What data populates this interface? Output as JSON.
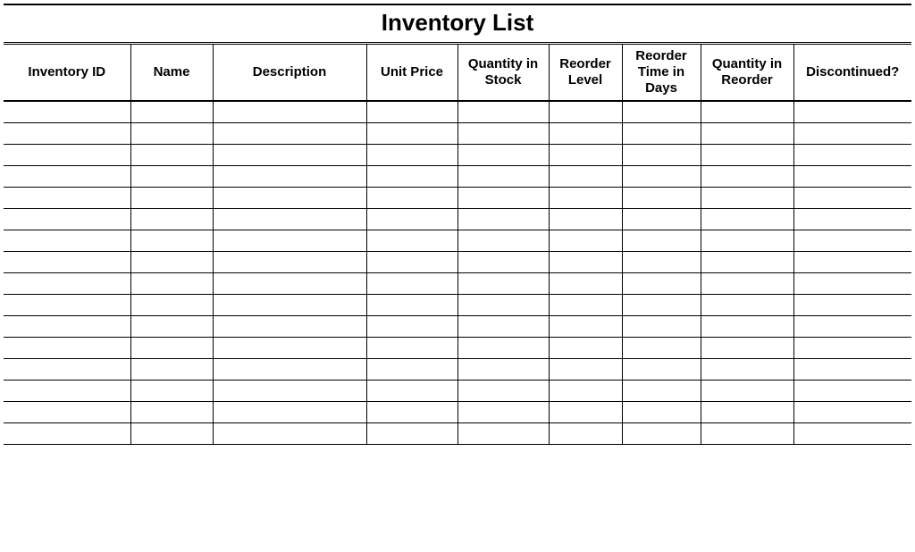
{
  "title": "Inventory List",
  "columns": [
    {
      "key": "inventory_id",
      "label": "Inventory ID"
    },
    {
      "key": "name",
      "label": "Name"
    },
    {
      "key": "description",
      "label": "Description"
    },
    {
      "key": "unit_price",
      "label": "Unit Price"
    },
    {
      "key": "qty_in_stock",
      "label": "Quantity in Stock"
    },
    {
      "key": "reorder_level",
      "label": "Reorder Level"
    },
    {
      "key": "reorder_time_days",
      "label": "Reorder Time in Days"
    },
    {
      "key": "qty_in_reorder",
      "label": "Quantity in Reorder"
    },
    {
      "key": "discontinued",
      "label": "Discontinued?"
    }
  ],
  "rows": [
    {
      "inventory_id": "",
      "name": "",
      "description": "",
      "unit_price": "",
      "qty_in_stock": "",
      "reorder_level": "",
      "reorder_time_days": "",
      "qty_in_reorder": "",
      "discontinued": ""
    },
    {
      "inventory_id": "",
      "name": "",
      "description": "",
      "unit_price": "",
      "qty_in_stock": "",
      "reorder_level": "",
      "reorder_time_days": "",
      "qty_in_reorder": "",
      "discontinued": ""
    },
    {
      "inventory_id": "",
      "name": "",
      "description": "",
      "unit_price": "",
      "qty_in_stock": "",
      "reorder_level": "",
      "reorder_time_days": "",
      "qty_in_reorder": "",
      "discontinued": ""
    },
    {
      "inventory_id": "",
      "name": "",
      "description": "",
      "unit_price": "",
      "qty_in_stock": "",
      "reorder_level": "",
      "reorder_time_days": "",
      "qty_in_reorder": "",
      "discontinued": ""
    },
    {
      "inventory_id": "",
      "name": "",
      "description": "",
      "unit_price": "",
      "qty_in_stock": "",
      "reorder_level": "",
      "reorder_time_days": "",
      "qty_in_reorder": "",
      "discontinued": ""
    },
    {
      "inventory_id": "",
      "name": "",
      "description": "",
      "unit_price": "",
      "qty_in_stock": "",
      "reorder_level": "",
      "reorder_time_days": "",
      "qty_in_reorder": "",
      "discontinued": ""
    },
    {
      "inventory_id": "",
      "name": "",
      "description": "",
      "unit_price": "",
      "qty_in_stock": "",
      "reorder_level": "",
      "reorder_time_days": "",
      "qty_in_reorder": "",
      "discontinued": ""
    },
    {
      "inventory_id": "",
      "name": "",
      "description": "",
      "unit_price": "",
      "qty_in_stock": "",
      "reorder_level": "",
      "reorder_time_days": "",
      "qty_in_reorder": "",
      "discontinued": ""
    },
    {
      "inventory_id": "",
      "name": "",
      "description": "",
      "unit_price": "",
      "qty_in_stock": "",
      "reorder_level": "",
      "reorder_time_days": "",
      "qty_in_reorder": "",
      "discontinued": ""
    },
    {
      "inventory_id": "",
      "name": "",
      "description": "",
      "unit_price": "",
      "qty_in_stock": "",
      "reorder_level": "",
      "reorder_time_days": "",
      "qty_in_reorder": "",
      "discontinued": ""
    },
    {
      "inventory_id": "",
      "name": "",
      "description": "",
      "unit_price": "",
      "qty_in_stock": "",
      "reorder_level": "",
      "reorder_time_days": "",
      "qty_in_reorder": "",
      "discontinued": ""
    },
    {
      "inventory_id": "",
      "name": "",
      "description": "",
      "unit_price": "",
      "qty_in_stock": "",
      "reorder_level": "",
      "reorder_time_days": "",
      "qty_in_reorder": "",
      "discontinued": ""
    },
    {
      "inventory_id": "",
      "name": "",
      "description": "",
      "unit_price": "",
      "qty_in_stock": "",
      "reorder_level": "",
      "reorder_time_days": "",
      "qty_in_reorder": "",
      "discontinued": ""
    },
    {
      "inventory_id": "",
      "name": "",
      "description": "",
      "unit_price": "",
      "qty_in_stock": "",
      "reorder_level": "",
      "reorder_time_days": "",
      "qty_in_reorder": "",
      "discontinued": ""
    },
    {
      "inventory_id": "",
      "name": "",
      "description": "",
      "unit_price": "",
      "qty_in_stock": "",
      "reorder_level": "",
      "reorder_time_days": "",
      "qty_in_reorder": "",
      "discontinued": ""
    },
    {
      "inventory_id": "",
      "name": "",
      "description": "",
      "unit_price": "",
      "qty_in_stock": "",
      "reorder_level": "",
      "reorder_time_days": "",
      "qty_in_reorder": "",
      "discontinued": ""
    }
  ]
}
